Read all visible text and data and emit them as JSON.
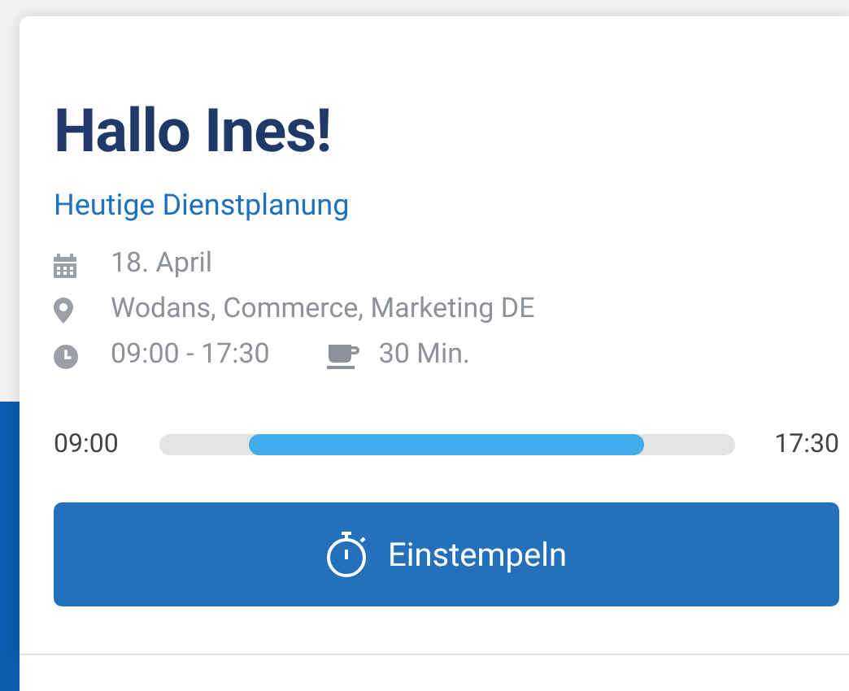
{
  "greeting": "Hallo Ines!",
  "subtitle": "Heutige Dienstplanung",
  "details": [
    {
      "kind": "date",
      "text": "18. April"
    },
    {
      "kind": "location",
      "text": "Wodans, Commerce, Marketing DE"
    }
  ],
  "shift": {
    "time": "09:00 - 17:30",
    "break": "30 Min."
  },
  "timeline": {
    "start": "09:00",
    "end": "17:30",
    "level": 0.813
  },
  "clock_in_button": {
    "label": "Einstempeln"
  }
}
